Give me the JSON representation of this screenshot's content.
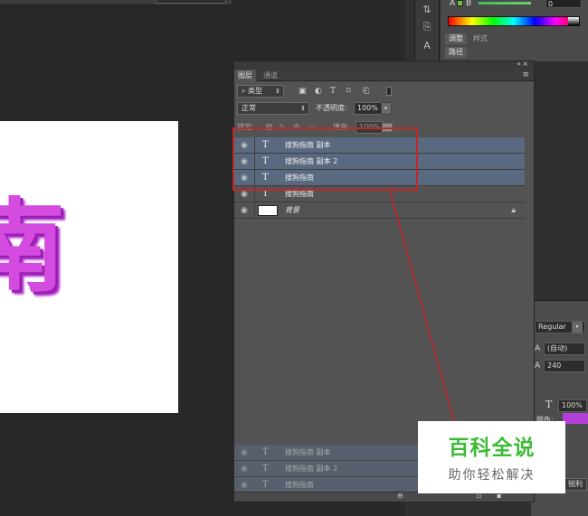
{
  "canvas": {
    "glyph": "南"
  },
  "color_panel": {
    "channel_label": "B",
    "value": "0",
    "tabs_row1": [
      "调整",
      "样式"
    ],
    "tabs_row2": [
      "路径"
    ]
  },
  "layers_panel": {
    "tabs": [
      "图层",
      "通道"
    ],
    "collapse_icon": "«",
    "close_icon": "×",
    "menu_icon": "≡",
    "filter": {
      "kind": "类型"
    },
    "blend_mode": "正常",
    "opacity_label": "不透明度:",
    "opacity_value": "100%",
    "lock_label": "锁定:",
    "fill_label": "填充:",
    "fill_value": "100%",
    "layers": [
      {
        "name": "搜狗指南 副本",
        "type": "text",
        "selected": true
      },
      {
        "name": "搜狗指南 副本 2",
        "type": "text",
        "selected": true
      },
      {
        "name": "搜狗指南",
        "type": "text",
        "selected": true
      },
      {
        "name": "搜狗指南",
        "type": "text",
        "selected": false
      },
      {
        "name": "背景",
        "type": "background",
        "selected": false,
        "locked": true
      }
    ],
    "ghost_layers": [
      "搜狗指南 副本",
      "搜狗指南 副本 2",
      "搜狗指南"
    ]
  },
  "character_panel": {
    "font_style": "Regular",
    "leading": "(自动)",
    "tracking": "240",
    "vertical_scale": "100%",
    "color_label": "颜色:",
    "sharpen": "锐利"
  },
  "watermark": {
    "title": "百科全说",
    "subtitle": "助你轻松解决"
  },
  "colors": {
    "selection_highlight": "#c0282a",
    "glyph_color": "#d44be0",
    "watermark_green": "#3dbb36"
  }
}
